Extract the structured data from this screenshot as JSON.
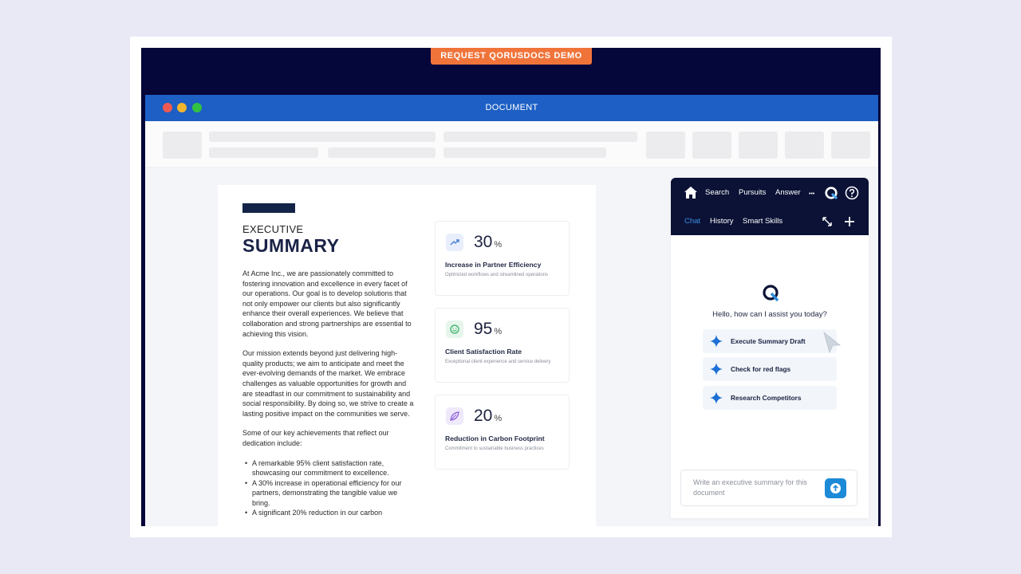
{
  "promo_button": {
    "label": "REQUEST QORUSDOCS DEMO"
  },
  "window": {
    "title": "DOCUMENT"
  },
  "document": {
    "kicker": "EXECUTIVE",
    "title": "SUMMARY",
    "paragraphs": [
      "At Acme Inc., we are passionately committed to fostering innovation and excellence in every facet of our operations. Our goal is to develop solutions that not only empower our clients but also significantly enhance their overall experiences. We believe that collaboration and strong partnerships are essential to achieving this vision.",
      "Our mission extends beyond just delivering high-quality products; we aim to anticipate and meet the ever-evolving demands of the market. We embrace challenges as valuable opportunities for growth and are steadfast in our commitment to sustainability and social responsibility. By doing so, we strive to create a lasting positive impact on the communities we serve.",
      "Some of our key achievements that reflect our dedication include:"
    ],
    "bullets": [
      "A remarkable 95% client satisfaction rate, showcasing our commitment to excellence.",
      "A 30% increase in operational efficiency for our partners, demonstrating the tangible value we bring.",
      "A significant 20% reduction in our carbon"
    ]
  },
  "stats": [
    {
      "value": "30",
      "unit": "%",
      "label": "Increase in Partner Efficiency",
      "sub": "Optimized workflows and streamlined operations",
      "icon": "trend-up-icon"
    },
    {
      "value": "95",
      "unit": "%",
      "label": "Client Satisfaction Rate",
      "sub": "Exceptional client experience and service delivery",
      "icon": "smile-icon"
    },
    {
      "value": "20",
      "unit": "%",
      "label": "Reduction in Carbon Footprint",
      "sub": "Commitment to sustainable business practices",
      "icon": "leaf-icon"
    }
  ],
  "assistant": {
    "nav": {
      "search": "Search",
      "pursuits": "Pursuits",
      "answer": "Answer",
      "more": "•••"
    },
    "tabs": {
      "chat": "Chat",
      "history": "History",
      "smart_skills": "Smart Skills"
    },
    "greeting": "Hello, how can I assist you today?",
    "suggestions": [
      "Execute Summary Draft",
      "Check for red flags",
      "Research Competitors"
    ],
    "composer_placeholder": "Write an executive summary for this document"
  },
  "colors": {
    "stage_bg": "#05063a",
    "titlebar": "#1d5fc4",
    "accent_orange": "#f0743a",
    "panel_header": "#0b1236",
    "active_tab": "#3d8ee6",
    "send_button": "#1d8ad8",
    "traffic_lights": [
      "#ee5a52",
      "#f3b52d",
      "#33c143"
    ]
  }
}
